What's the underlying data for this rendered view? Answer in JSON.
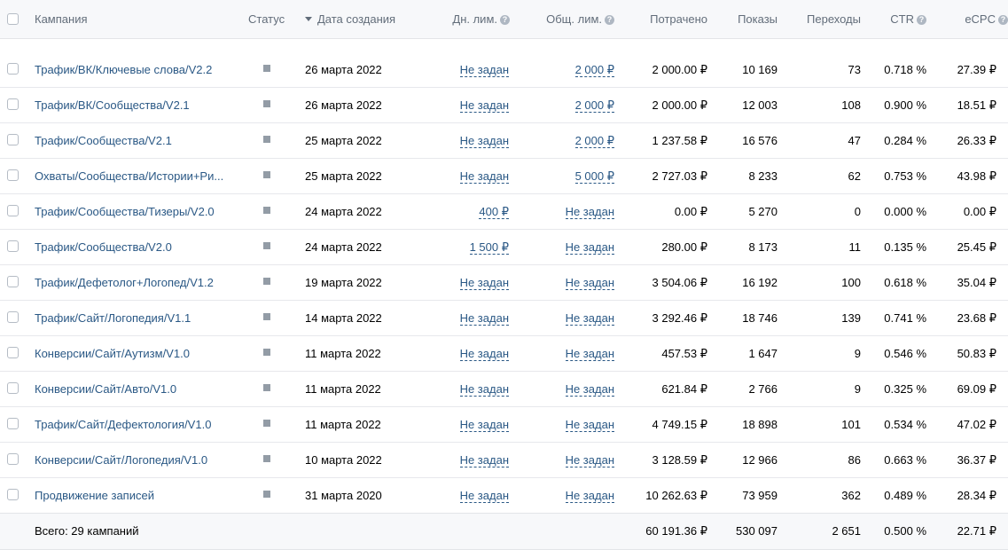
{
  "header": {
    "campaign": "Кампания",
    "status": "Статус",
    "date": "Дата создания",
    "daily_limit": "Дн. лим.",
    "total_limit": "Общ. лим.",
    "spent": "Потрачено",
    "impressions": "Показы",
    "clicks": "Переходы",
    "ctr": "CTR",
    "ecpc": "eCPC"
  },
  "rows": [
    {
      "name": "Трафик/ВК/Ключевые слова/V2.2",
      "date": "26 марта 2022",
      "daily": "Не задан",
      "total": "2 000 ₽",
      "spent": "2 000.00 ₽",
      "impressions": "10 169",
      "clicks": "73",
      "ctr": "0.718 %",
      "ecpc": "27.39 ₽"
    },
    {
      "name": "Трафик/ВК/Сообщества/V2.1",
      "date": "26 марта 2022",
      "daily": "Не задан",
      "total": "2 000 ₽",
      "spent": "2 000.00 ₽",
      "impressions": "12 003",
      "clicks": "108",
      "ctr": "0.900 %",
      "ecpc": "18.51 ₽"
    },
    {
      "name": "Трафик/Сообщества/V2.1",
      "date": "25 марта 2022",
      "daily": "Не задан",
      "total": "2 000 ₽",
      "spent": "1 237.58 ₽",
      "impressions": "16 576",
      "clicks": "47",
      "ctr": "0.284 %",
      "ecpc": "26.33 ₽"
    },
    {
      "name": "Охваты/Сообщества/Истории+Ри...",
      "date": "25 марта 2022",
      "daily": "Не задан",
      "total": "5 000 ₽",
      "spent": "2 727.03 ₽",
      "impressions": "8 233",
      "clicks": "62",
      "ctr": "0.753 %",
      "ecpc": "43.98 ₽"
    },
    {
      "name": "Трафик/Сообщества/Тизеры/V2.0",
      "date": "24 марта 2022",
      "daily": "400 ₽",
      "total": "Не задан",
      "spent": "0.00 ₽",
      "impressions": "5 270",
      "clicks": "0",
      "ctr": "0.000 %",
      "ecpc": "0.00 ₽"
    },
    {
      "name": "Трафик/Сообщества/V2.0",
      "date": "24 марта 2022",
      "daily": "1 500 ₽",
      "total": "Не задан",
      "spent": "280.00 ₽",
      "impressions": "8 173",
      "clicks": "11",
      "ctr": "0.135 %",
      "ecpc": "25.45 ₽"
    },
    {
      "name": "Трафик/Дефетолог+Логопед/V1.2",
      "date": "19 марта 2022",
      "daily": "Не задан",
      "total": "Не задан",
      "spent": "3 504.06 ₽",
      "impressions": "16 192",
      "clicks": "100",
      "ctr": "0.618 %",
      "ecpc": "35.04 ₽"
    },
    {
      "name": "Трафик/Сайт/Логопедия/V1.1",
      "date": "14 марта 2022",
      "daily": "Не задан",
      "total": "Не задан",
      "spent": "3 292.46 ₽",
      "impressions": "18 746",
      "clicks": "139",
      "ctr": "0.741 %",
      "ecpc": "23.68 ₽"
    },
    {
      "name": "Конверсии/Сайт/Аутизм/V1.0",
      "date": "11 марта 2022",
      "daily": "Не задан",
      "total": "Не задан",
      "spent": "457.53 ₽",
      "impressions": "1 647",
      "clicks": "9",
      "ctr": "0.546 %",
      "ecpc": "50.83 ₽"
    },
    {
      "name": "Конверсии/Сайт/Авто/V1.0",
      "date": "11 марта 2022",
      "daily": "Не задан",
      "total": "Не задан",
      "spent": "621.84 ₽",
      "impressions": "2 766",
      "clicks": "9",
      "ctr": "0.325 %",
      "ecpc": "69.09 ₽"
    },
    {
      "name": "Трафик/Сайт/Дефектология/V1.0",
      "date": "11 марта 2022",
      "daily": "Не задан",
      "total": "Не задан",
      "spent": "4 749.15 ₽",
      "impressions": "18 898",
      "clicks": "101",
      "ctr": "0.534 %",
      "ecpc": "47.02 ₽"
    },
    {
      "name": "Конверсии/Сайт/Логопедия/V1.0",
      "date": "10 марта 2022",
      "daily": "Не задан",
      "total": "Не задан",
      "spent": "3 128.59 ₽",
      "impressions": "12 966",
      "clicks": "86",
      "ctr": "0.663 %",
      "ecpc": "36.37 ₽"
    },
    {
      "name": "Продвижение записей",
      "date": "31 марта 2020",
      "daily": "Не задан",
      "total": "Не задан",
      "spent": "10 262.63 ₽",
      "impressions": "73 959",
      "clicks": "362",
      "ctr": "0.489 %",
      "ecpc": "28.34 ₽"
    }
  ],
  "totals": {
    "label": "Всего: 29 кампаний",
    "spent": "60 191.36 ₽",
    "impressions": "530 097",
    "clicks": "2 651",
    "ctr": "0.500 %",
    "ecpc": "22.71 ₽"
  },
  "icons": {
    "sort": "sort-descending-icon",
    "help": "question-circle-icon",
    "status": "status-square-icon"
  },
  "colors": {
    "link": "#2a5885",
    "header_bg": "#f7f8fa",
    "header_text": "#626d7a",
    "status_square": "#939ca6"
  }
}
